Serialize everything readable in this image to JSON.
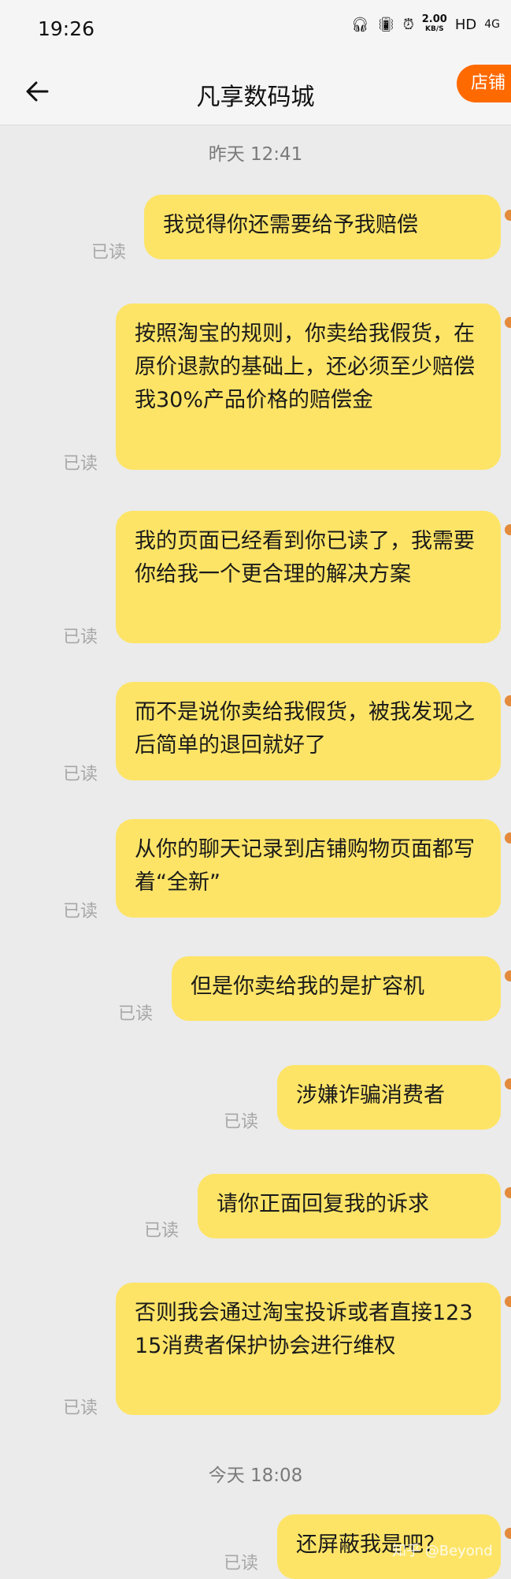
{
  "status_bar": {
    "time": "19:26",
    "net_speed": "2.00",
    "net_unit": "KB/S",
    "hd": "HD",
    "signal": "4G"
  },
  "nav": {
    "title": "凡享数码城",
    "shop_button": "店铺"
  },
  "timestamps": [
    "昨天  12:41",
    "今天  18:08"
  ],
  "read_label": "已读",
  "messages": [
    {
      "text": "我觉得你还需要给予我赔偿",
      "status": "已读"
    },
    {
      "text": "按照淘宝的规则，你卖给我假货，在原价退款的基础上，还必须至少赔偿我30%产品价格的赔偿金",
      "status": "已读"
    },
    {
      "text": "我的页面已经看到你已读了，我需要你给我一个更合理的解决方案",
      "status": "已读"
    },
    {
      "text": "而不是说你卖给我假货，被我发现之后简单的退回就好了",
      "status": "已读"
    },
    {
      "text": "从你的聊天记录到店铺购物页面都写着“全新”",
      "status": "已读"
    },
    {
      "text": "但是你卖给我的是扩容机",
      "status": "已读"
    },
    {
      "text": "涉嫌诈骗消费者",
      "status": "已读"
    },
    {
      "text": "请你正面回复我的诉求",
      "status": "已读"
    },
    {
      "text": "否则我会通过淘宝投诉或者直接12315消费者保护协会进行维权",
      "status": "已读"
    },
    {
      "text": "还屏蔽我是吧？",
      "status": "已读"
    }
  ],
  "watermark": "知乎 @Beyond",
  "colors": {
    "bubble": "#fde467",
    "accent": "#ff6a00",
    "background": "#ebebeb"
  }
}
